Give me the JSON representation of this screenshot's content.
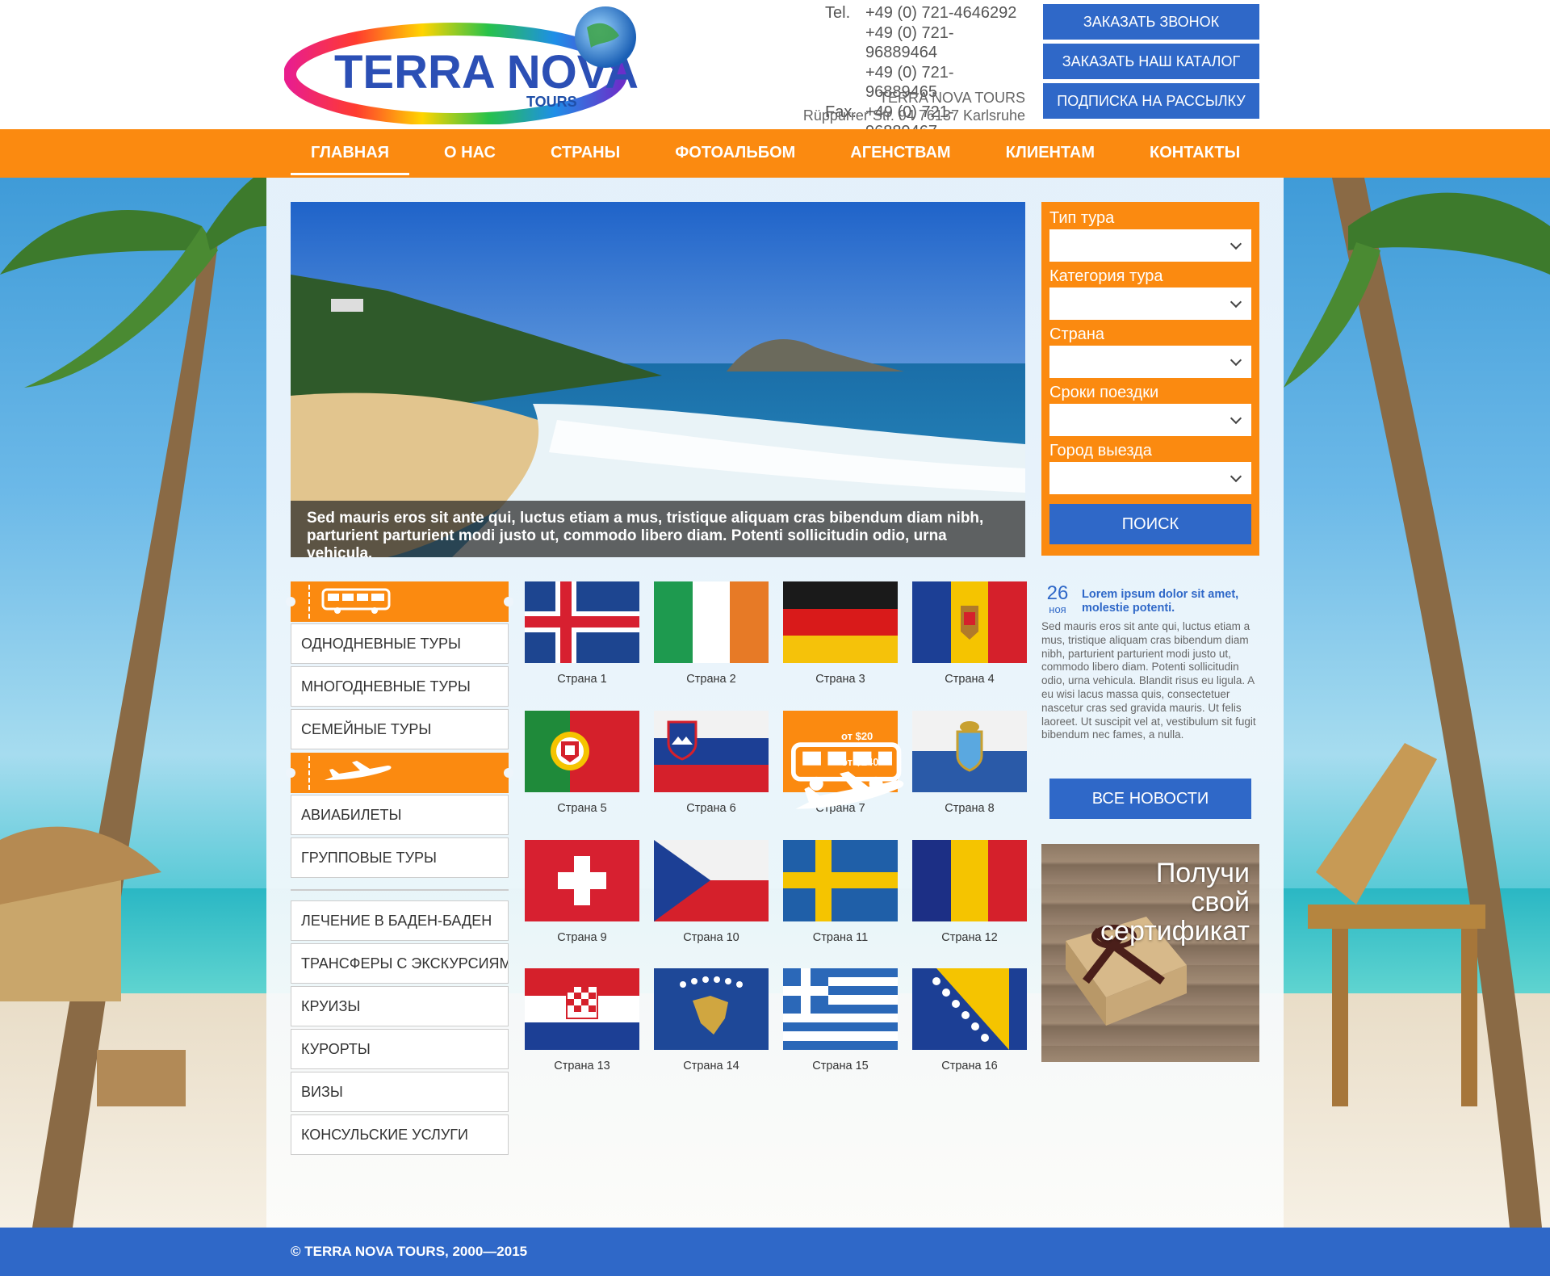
{
  "brand": {
    "name": "TERRA NOVA",
    "sub": "TOURS"
  },
  "contacts": {
    "tel_label": "Tel.",
    "fax_label": "Fax.",
    "phones": [
      "+49 (0) 721-4646292",
      "+49 (0) 721-96889464",
      "+49 (0) 721-96889465"
    ],
    "fax": "+49 (0) 721-96889467",
    "company": "TERRA NOVA TOURS",
    "address": "Rüppurrer Str. 94  76137 Karlsruhe"
  },
  "top_buttons": [
    "ЗАКАЗАТЬ ЗВОНОК",
    "ЗАКАЗАТЬ НАШ КАТАЛОГ",
    "ПОДПИСКА НА РАССЫЛКУ"
  ],
  "nav": [
    "ГЛАВНАЯ",
    "О НАС",
    "СТРАНЫ",
    "ФОТОАЛЬБОМ",
    "АГЕНСТВАМ",
    "КЛИЕНТАМ",
    "КОНТАКТЫ"
  ],
  "hero": {
    "caption_1": "Sed mauris eros sit ante qui, luctus etiam a mus, tristique aliquam cras bibendum diam nibh,",
    "caption_2": "parturient parturient modi justo ut, commodo libero diam. Potenti sollicitudin odio, urna vehicula."
  },
  "search": {
    "labels": [
      "Тип тура",
      "Категория тура",
      "Страна",
      "Сроки поездки",
      "Город выезда"
    ],
    "button": "ПОИСК"
  },
  "news": {
    "day": "26",
    "month": "ноя",
    "title": "Lorem ipsum dolor sit amet, molestie potenti.",
    "text": "Sed mauris eros sit ante qui, luctus etiam a mus, tristique aliquam cras bibendum diam nibh, parturient parturient modi justo ut, commodo libero diam. Potenti sollicitudin odio, urna vehicula. Blandit risus eu ligula. A eu wisi lacus massa quis, consectetuer nascetur cras sed gravida mauris. Ut felis laoreet. Ut suscipit vel at, vestibulum sit fugit bibendum nec fames, a nulla.",
    "all_button": "ВСЕ НОВОСТИ"
  },
  "certificate": {
    "line1": "Получи",
    "line2": "свой",
    "line3": "сертификат"
  },
  "menu": {
    "bus_group": [
      "ОДНОДНЕВНЫЕ ТУРЫ",
      "МНОГОДНЕВНЫЕ ТУРЫ",
      "СЕМЕЙНЫЕ ТУРЫ"
    ],
    "air_group": [
      "АВИАБИЛЕТЫ",
      "ГРУППОВЫЕ ТУРЫ"
    ],
    "other_group": [
      "ЛЕЧЕНИЕ В БАДЕН-БАДЕН",
      "ТРАНСФЕРЫ С ЭКСКУРСИЯМИ",
      "КРУИЗЫ",
      "КУРОРТЫ",
      "ВИЗЫ",
      "КОНСУЛЬСКИЕ УСЛУГИ"
    ]
  },
  "countries": [
    "Страна 1",
    "Страна 2",
    "Страна 3",
    "Страна 4",
    "Страна 5",
    "Страна 6",
    "Страна 7",
    "Страна 8",
    "Страна 9",
    "Страна 10",
    "Страна 11",
    "Страна 12",
    "Страна 13",
    "Страна 14",
    "Страна 15",
    "Страна 16"
  ],
  "promo": {
    "bus_price": "от $20",
    "air_price": "от $240"
  },
  "footer": "© TERRA NOVA TOURS, 2000—2015",
  "colors": {
    "orange": "#fb8a10",
    "blue": "#2f68c8"
  }
}
